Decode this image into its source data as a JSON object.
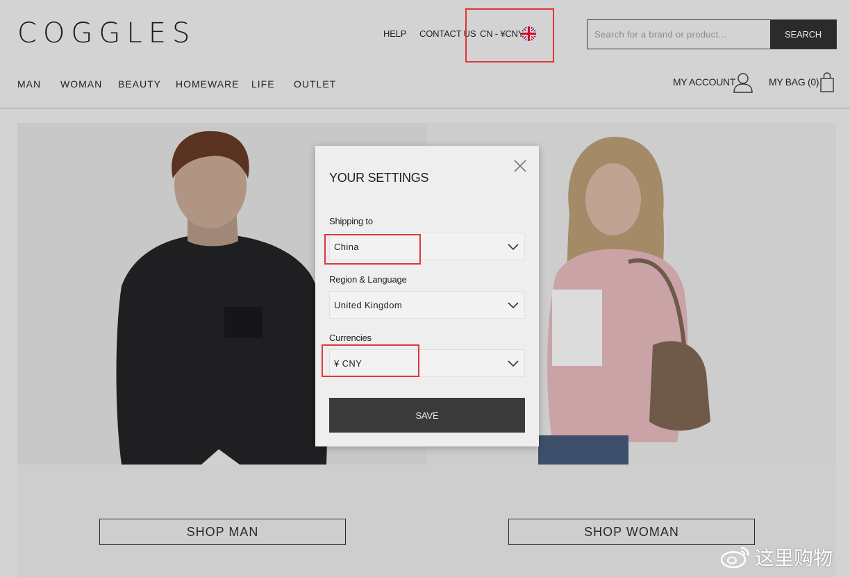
{
  "header": {
    "logo": "COGGLES",
    "links": {
      "help": "HELP",
      "contact": "CONTACT US",
      "currency": "CN - ¥CNY"
    },
    "flag_icon": "uk-flag-icon",
    "search": {
      "placeholder": "Search for a brand or product...",
      "button": "SEARCH"
    },
    "nav": [
      "MAN",
      "WOMAN",
      "BEAUTY",
      "HOMEWARE",
      "LIFE",
      "OUTLET"
    ],
    "account": {
      "label": "MY ACCOUNT",
      "icon": "user-icon"
    },
    "bag": {
      "label": "MY BAG (0)",
      "icon": "shopping-bag-icon"
    }
  },
  "hero": {
    "shop_man": "SHOP MAN",
    "shop_woman": "SHOP WOMAN"
  },
  "modal": {
    "title": "YOUR SETTINGS",
    "close_icon": "close-icon",
    "fields": {
      "shipping": {
        "label": "Shipping to",
        "value": "China"
      },
      "region": {
        "label": "Region & Language",
        "value": "United Kingdom"
      },
      "currency": {
        "label": "Currencies",
        "value": "¥ CNY"
      }
    },
    "save": "SAVE"
  },
  "watermark": {
    "text": "这里购物",
    "icon": "weibo-logo-icon"
  },
  "colors": {
    "overlay_background": "#d3d3d3",
    "modal_background": "#eeeeee",
    "button_dark": "#2b2b2b",
    "highlight_red": "#e0363a"
  }
}
